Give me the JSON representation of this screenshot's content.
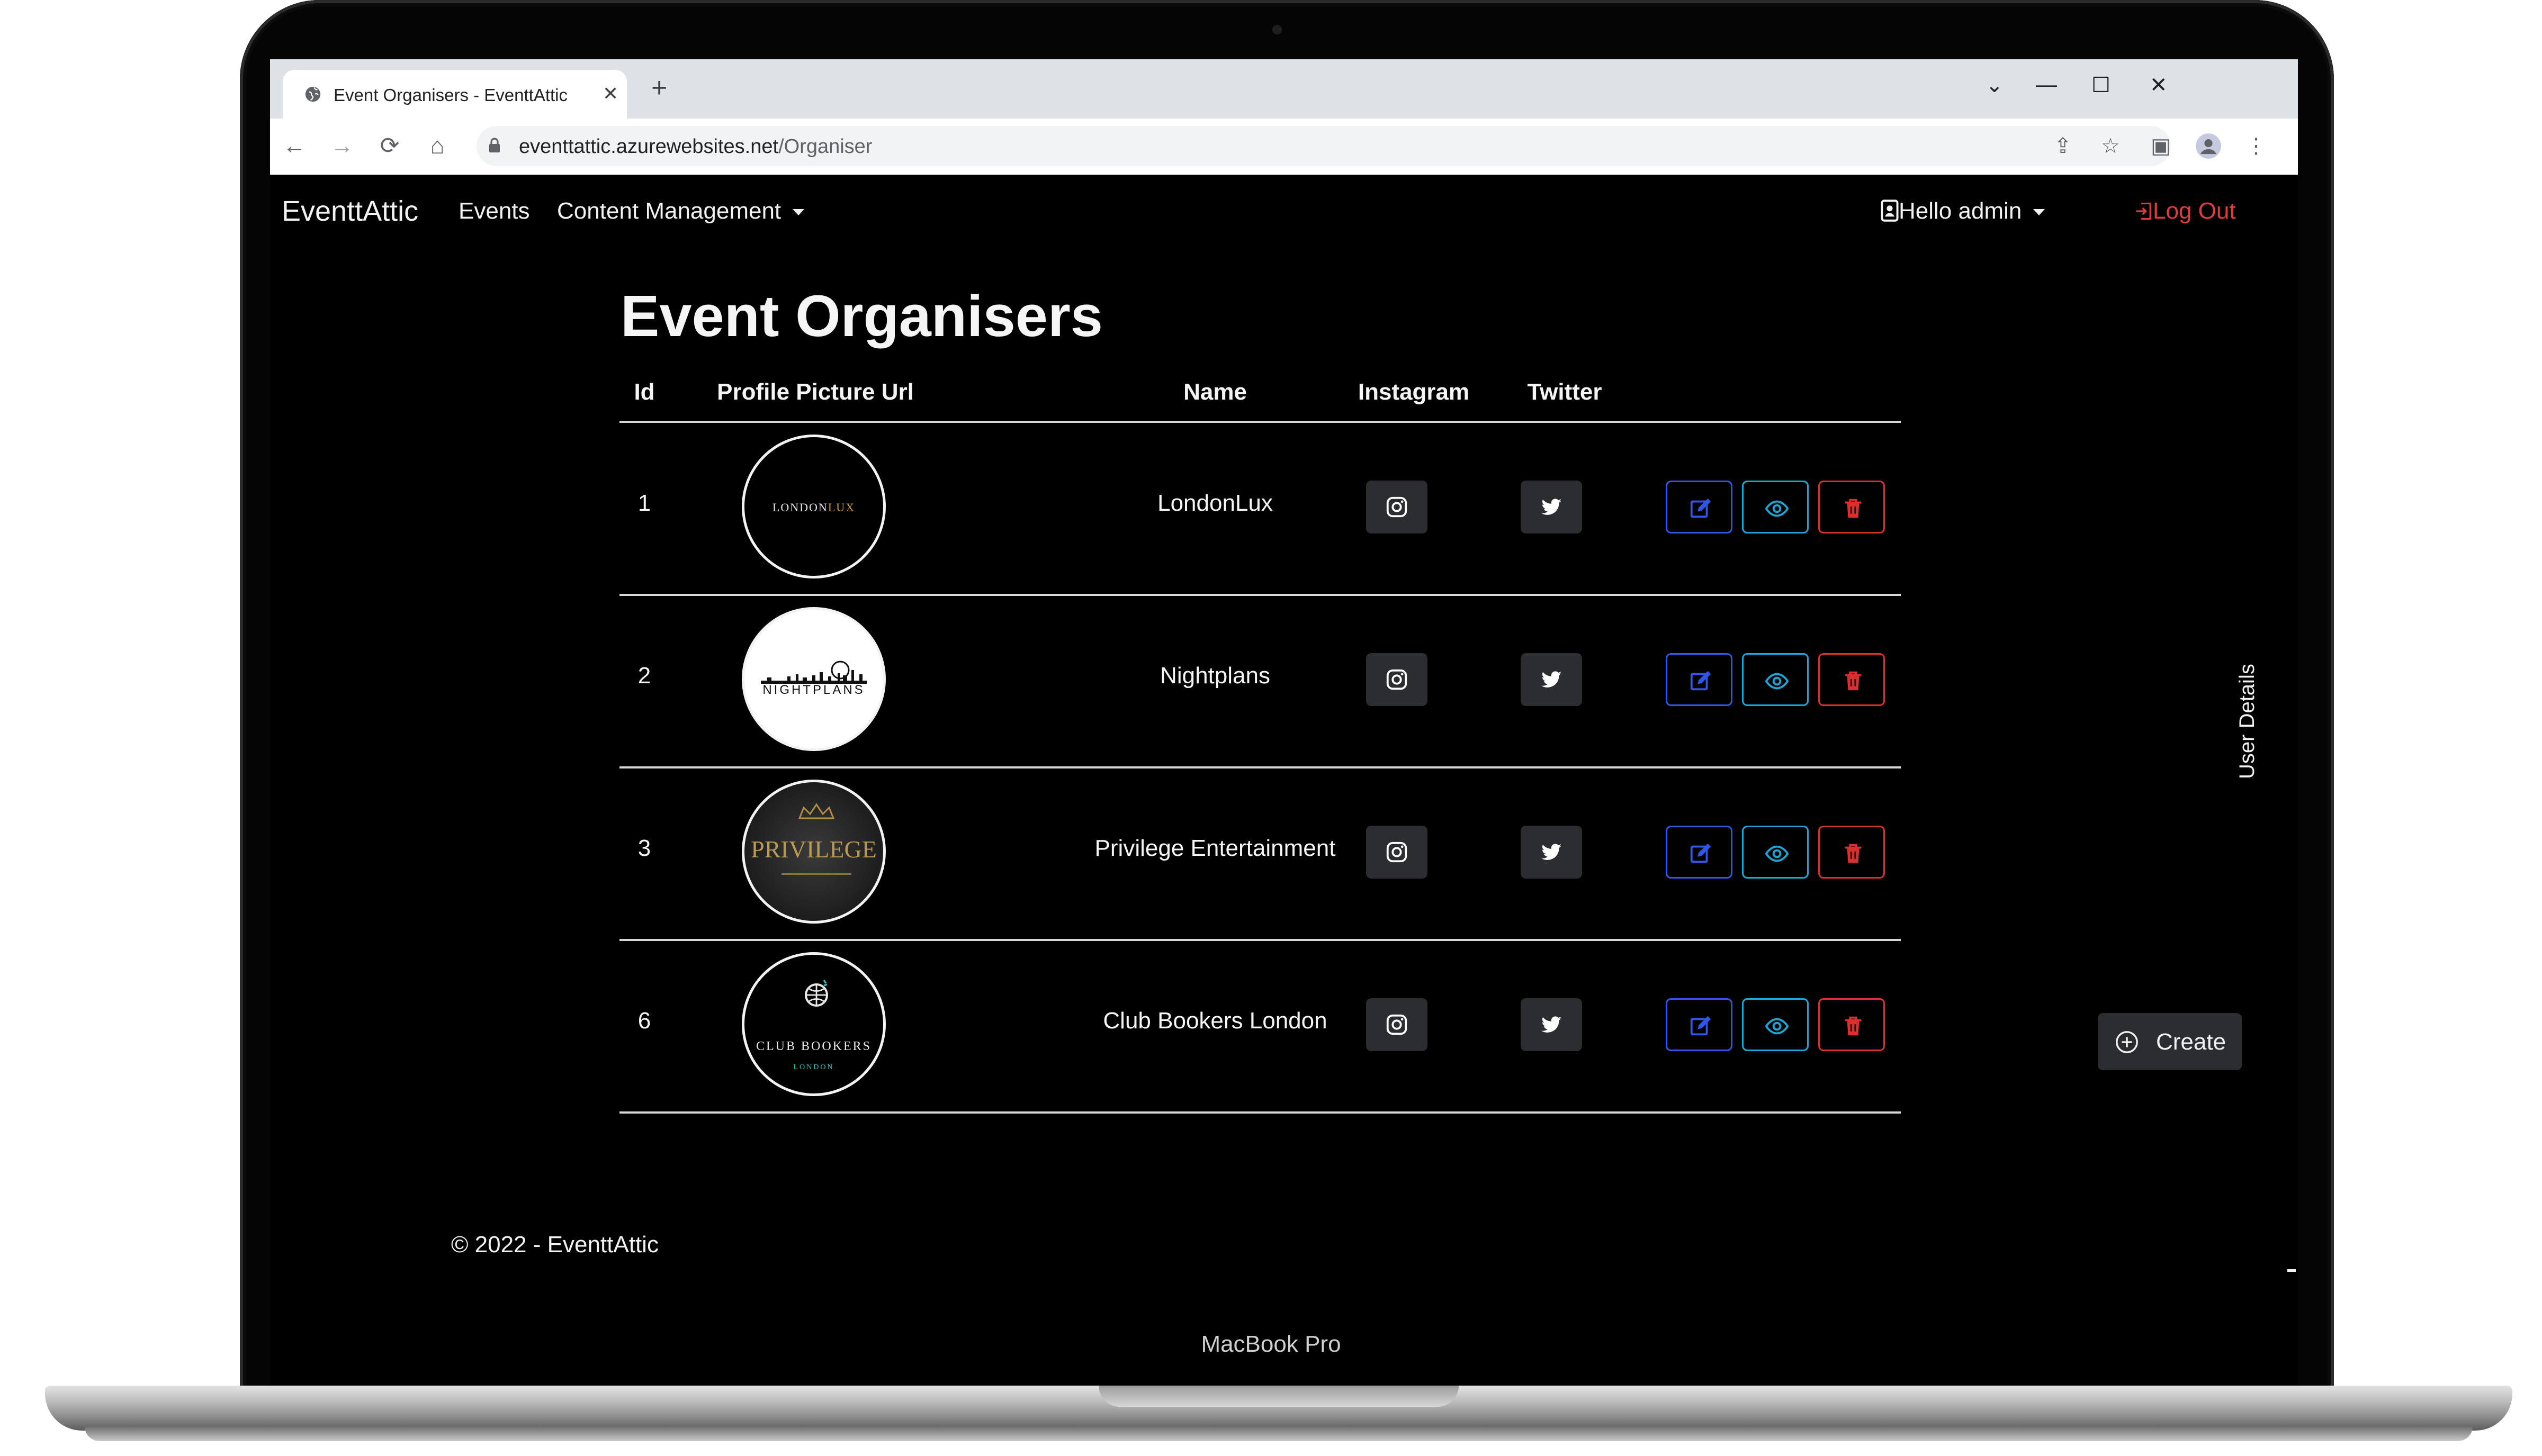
{
  "browser": {
    "tab_title": "Event Organisers - EventtAttic",
    "url_host": "eventtattic.azurewebsites.net",
    "url_path": "/Organiser"
  },
  "navbar": {
    "brand": "EventtAttic",
    "links": [
      {
        "label": "Events"
      },
      {
        "label": "Content Management"
      }
    ],
    "user_greeting": "Hello admin",
    "logout_label": "Log Out"
  },
  "page": {
    "title": "Event Organisers",
    "columns": [
      "Id",
      "Profile Picture Url",
      "Name",
      "Instagram",
      "Twitter"
    ],
    "rows": [
      {
        "id": "1",
        "name": "LondonLux",
        "logo": {
          "text_a": "LONDON",
          "text_b": "LUX"
        }
      },
      {
        "id": "2",
        "name": "Nightplans",
        "logo": {
          "text_a": "NIGHTPLANS"
        }
      },
      {
        "id": "3",
        "name": "Privilege Entertainment",
        "logo": {
          "text_a": "PRIVILEGE"
        }
      },
      {
        "id": "6",
        "name": "Club Bookers London",
        "logo": {
          "text_a": "CLUB BOOKERS",
          "text_b": "LONDON"
        }
      }
    ],
    "side_panel_label": "User Details",
    "create_label": "Create",
    "footer": "© 2022 - EventtAttic"
  },
  "device_label": "MacBook Pro",
  "colors": {
    "edit": "#2f56e6",
    "view": "#1aa7d8",
    "delete": "#d9302f",
    "logout": "#e23b3b"
  },
  "icons": [
    "instagram-icon",
    "twitter-icon",
    "edit-icon",
    "eye-icon",
    "trash-icon",
    "plus-circle-icon",
    "user-icon",
    "logout-icon"
  ]
}
